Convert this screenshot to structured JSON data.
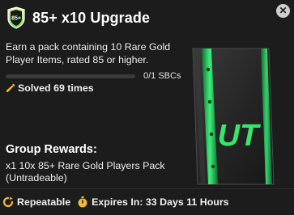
{
  "header": {
    "badge_text": "85+",
    "title": "85+ x10 Upgrade",
    "info_icon": "close-icon"
  },
  "description": "Earn a pack containing 10 Rare Gold Player Items, rated 85 or higher.",
  "progress": {
    "completed": 0,
    "total": 1,
    "label": "0/1 SBCs",
    "fill_fraction": 0
  },
  "solved": {
    "icon": "wrench-icon",
    "label": "Solved 69 times"
  },
  "pack": {
    "logo_text": "UT",
    "accent_color": "#34e86a"
  },
  "rewards": {
    "title": "Group Rewards:",
    "description": "x1 10x 85+ Rare Gold Players Pack (Untradeable)"
  },
  "footer": {
    "repeatable_icon": "repeat-icon",
    "repeatable_label": "Repeatable",
    "expires_icon": "stopwatch-icon",
    "expires_label": "Expires In: 33 Days 11 Hours"
  },
  "colors": {
    "background": "#1c1c1c",
    "accent_green": "#3fd96b",
    "icon_gold": "#f5b82e"
  }
}
